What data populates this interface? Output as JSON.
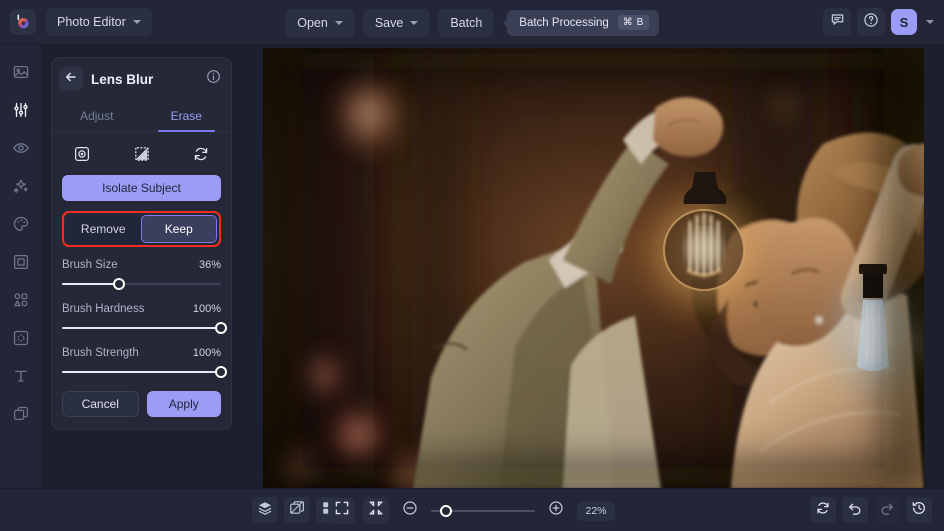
{
  "topbar": {
    "logo_icon": "color-wheel-logo",
    "app_name": "Photo Editor",
    "app_chevron_icon": "chevron-down-icon",
    "open_label": "Open",
    "open_chevron_icon": "chevron-down-icon",
    "save_label": "Save",
    "save_chevron_icon": "chevron-down-icon",
    "batch_label": "Batch",
    "tooltip_text": "Batch Processing",
    "tooltip_shortcut": "⌘ B",
    "feedback_icon": "chat-bubble-icon",
    "help_icon": "question-circle-icon",
    "avatar_initial": "S",
    "avatar_chevron_icon": "chevron-down-icon",
    "accent_color": "#9b9cf5"
  },
  "rail": {
    "items": [
      {
        "icon": "image-icon",
        "active": false
      },
      {
        "icon": "sliders-adjust-icon",
        "active": true
      },
      {
        "icon": "eye-icon",
        "active": false
      },
      {
        "icon": "sparkles-icon",
        "active": false
      },
      {
        "icon": "color-palette-icon",
        "active": false
      },
      {
        "icon": "frame-icon",
        "active": false
      },
      {
        "icon": "shapes-icon",
        "active": false
      },
      {
        "icon": "blur-retouch-icon",
        "active": false
      },
      {
        "icon": "text-tool-icon",
        "active": false
      },
      {
        "icon": "layers-stack-icon",
        "active": false
      }
    ]
  },
  "panel": {
    "back_icon": "arrow-left-icon",
    "title": "Lens Blur",
    "info_icon": "info-circle-icon",
    "tabs": [
      {
        "label": "Adjust",
        "active": false
      },
      {
        "label": "Erase",
        "active": true
      }
    ],
    "tools": [
      {
        "icon": "subject-select-icon"
      },
      {
        "icon": "mask-overlay-icon"
      },
      {
        "icon": "reset-refresh-icon"
      }
    ],
    "isolate_label": "Isolate Subject",
    "highlight_color": "#f02d1e",
    "segmented": {
      "options": [
        {
          "label": "Remove",
          "selected": false
        },
        {
          "label": "Keep",
          "selected": true
        }
      ]
    },
    "sliders": [
      {
        "label": "Brush Size",
        "value": "36%",
        "percent": 36
      },
      {
        "label": "Brush Hardness",
        "value": "100%",
        "percent": 100
      },
      {
        "label": "Brush Strength",
        "value": "100%",
        "percent": 100
      }
    ],
    "cancel_label": "Cancel",
    "apply_label": "Apply"
  },
  "bottombar": {
    "left_icons": [
      {
        "icon": "layers-icon"
      },
      {
        "icon": "compare-split-icon"
      },
      {
        "icon": "grid-view-icon"
      }
    ],
    "fullscreen_icon": "expand-fullscreen-icon",
    "fit_icon": "fit-to-screen-icon",
    "zoom_out_icon": "zoom-out-icon",
    "zoom_in_icon": "zoom-in-icon",
    "zoom_level": "22%",
    "zoom_percent": 14,
    "right_icons": [
      {
        "icon": "reset-rotate-icon",
        "dim": false
      },
      {
        "icon": "undo-icon",
        "dim": false
      },
      {
        "icon": "redo-icon",
        "dim": true
      },
      {
        "icon": "history-icon",
        "dim": false
      }
    ]
  },
  "canvas": {
    "image_description": "Wedding couple holding glowing edison bulbs, warm bokeh background"
  }
}
